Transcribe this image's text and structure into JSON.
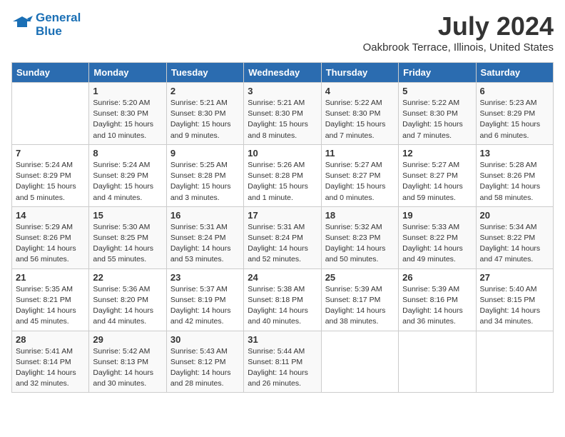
{
  "header": {
    "logo_line1": "General",
    "logo_line2": "Blue",
    "month": "July 2024",
    "location": "Oakbrook Terrace, Illinois, United States"
  },
  "columns": [
    "Sunday",
    "Monday",
    "Tuesday",
    "Wednesday",
    "Thursday",
    "Friday",
    "Saturday"
  ],
  "weeks": [
    [
      {
        "day": "",
        "sunrise": "",
        "sunset": "",
        "daylight": ""
      },
      {
        "day": "1",
        "sunrise": "Sunrise: 5:20 AM",
        "sunset": "Sunset: 8:30 PM",
        "daylight": "Daylight: 15 hours and 10 minutes."
      },
      {
        "day": "2",
        "sunrise": "Sunrise: 5:21 AM",
        "sunset": "Sunset: 8:30 PM",
        "daylight": "Daylight: 15 hours and 9 minutes."
      },
      {
        "day": "3",
        "sunrise": "Sunrise: 5:21 AM",
        "sunset": "Sunset: 8:30 PM",
        "daylight": "Daylight: 15 hours and 8 minutes."
      },
      {
        "day": "4",
        "sunrise": "Sunrise: 5:22 AM",
        "sunset": "Sunset: 8:30 PM",
        "daylight": "Daylight: 15 hours and 7 minutes."
      },
      {
        "day": "5",
        "sunrise": "Sunrise: 5:22 AM",
        "sunset": "Sunset: 8:30 PM",
        "daylight": "Daylight: 15 hours and 7 minutes."
      },
      {
        "day": "6",
        "sunrise": "Sunrise: 5:23 AM",
        "sunset": "Sunset: 8:29 PM",
        "daylight": "Daylight: 15 hours and 6 minutes."
      }
    ],
    [
      {
        "day": "7",
        "sunrise": "Sunrise: 5:24 AM",
        "sunset": "Sunset: 8:29 PM",
        "daylight": "Daylight: 15 hours and 5 minutes."
      },
      {
        "day": "8",
        "sunrise": "Sunrise: 5:24 AM",
        "sunset": "Sunset: 8:29 PM",
        "daylight": "Daylight: 15 hours and 4 minutes."
      },
      {
        "day": "9",
        "sunrise": "Sunrise: 5:25 AM",
        "sunset": "Sunset: 8:28 PM",
        "daylight": "Daylight: 15 hours and 3 minutes."
      },
      {
        "day": "10",
        "sunrise": "Sunrise: 5:26 AM",
        "sunset": "Sunset: 8:28 PM",
        "daylight": "Daylight: 15 hours and 1 minute."
      },
      {
        "day": "11",
        "sunrise": "Sunrise: 5:27 AM",
        "sunset": "Sunset: 8:27 PM",
        "daylight": "Daylight: 15 hours and 0 minutes."
      },
      {
        "day": "12",
        "sunrise": "Sunrise: 5:27 AM",
        "sunset": "Sunset: 8:27 PM",
        "daylight": "Daylight: 14 hours and 59 minutes."
      },
      {
        "day": "13",
        "sunrise": "Sunrise: 5:28 AM",
        "sunset": "Sunset: 8:26 PM",
        "daylight": "Daylight: 14 hours and 58 minutes."
      }
    ],
    [
      {
        "day": "14",
        "sunrise": "Sunrise: 5:29 AM",
        "sunset": "Sunset: 8:26 PM",
        "daylight": "Daylight: 14 hours and 56 minutes."
      },
      {
        "day": "15",
        "sunrise": "Sunrise: 5:30 AM",
        "sunset": "Sunset: 8:25 PM",
        "daylight": "Daylight: 14 hours and 55 minutes."
      },
      {
        "day": "16",
        "sunrise": "Sunrise: 5:31 AM",
        "sunset": "Sunset: 8:24 PM",
        "daylight": "Daylight: 14 hours and 53 minutes."
      },
      {
        "day": "17",
        "sunrise": "Sunrise: 5:31 AM",
        "sunset": "Sunset: 8:24 PM",
        "daylight": "Daylight: 14 hours and 52 minutes."
      },
      {
        "day": "18",
        "sunrise": "Sunrise: 5:32 AM",
        "sunset": "Sunset: 8:23 PM",
        "daylight": "Daylight: 14 hours and 50 minutes."
      },
      {
        "day": "19",
        "sunrise": "Sunrise: 5:33 AM",
        "sunset": "Sunset: 8:22 PM",
        "daylight": "Daylight: 14 hours and 49 minutes."
      },
      {
        "day": "20",
        "sunrise": "Sunrise: 5:34 AM",
        "sunset": "Sunset: 8:22 PM",
        "daylight": "Daylight: 14 hours and 47 minutes."
      }
    ],
    [
      {
        "day": "21",
        "sunrise": "Sunrise: 5:35 AM",
        "sunset": "Sunset: 8:21 PM",
        "daylight": "Daylight: 14 hours and 45 minutes."
      },
      {
        "day": "22",
        "sunrise": "Sunrise: 5:36 AM",
        "sunset": "Sunset: 8:20 PM",
        "daylight": "Daylight: 14 hours and 44 minutes."
      },
      {
        "day": "23",
        "sunrise": "Sunrise: 5:37 AM",
        "sunset": "Sunset: 8:19 PM",
        "daylight": "Daylight: 14 hours and 42 minutes."
      },
      {
        "day": "24",
        "sunrise": "Sunrise: 5:38 AM",
        "sunset": "Sunset: 8:18 PM",
        "daylight": "Daylight: 14 hours and 40 minutes."
      },
      {
        "day": "25",
        "sunrise": "Sunrise: 5:39 AM",
        "sunset": "Sunset: 8:17 PM",
        "daylight": "Daylight: 14 hours and 38 minutes."
      },
      {
        "day": "26",
        "sunrise": "Sunrise: 5:39 AM",
        "sunset": "Sunset: 8:16 PM",
        "daylight": "Daylight: 14 hours and 36 minutes."
      },
      {
        "day": "27",
        "sunrise": "Sunrise: 5:40 AM",
        "sunset": "Sunset: 8:15 PM",
        "daylight": "Daylight: 14 hours and 34 minutes."
      }
    ],
    [
      {
        "day": "28",
        "sunrise": "Sunrise: 5:41 AM",
        "sunset": "Sunset: 8:14 PM",
        "daylight": "Daylight: 14 hours and 32 minutes."
      },
      {
        "day": "29",
        "sunrise": "Sunrise: 5:42 AM",
        "sunset": "Sunset: 8:13 PM",
        "daylight": "Daylight: 14 hours and 30 minutes."
      },
      {
        "day": "30",
        "sunrise": "Sunrise: 5:43 AM",
        "sunset": "Sunset: 8:12 PM",
        "daylight": "Daylight: 14 hours and 28 minutes."
      },
      {
        "day": "31",
        "sunrise": "Sunrise: 5:44 AM",
        "sunset": "Sunset: 8:11 PM",
        "daylight": "Daylight: 14 hours and 26 minutes."
      },
      {
        "day": "",
        "sunrise": "",
        "sunset": "",
        "daylight": ""
      },
      {
        "day": "",
        "sunrise": "",
        "sunset": "",
        "daylight": ""
      },
      {
        "day": "",
        "sunrise": "",
        "sunset": "",
        "daylight": ""
      }
    ]
  ]
}
